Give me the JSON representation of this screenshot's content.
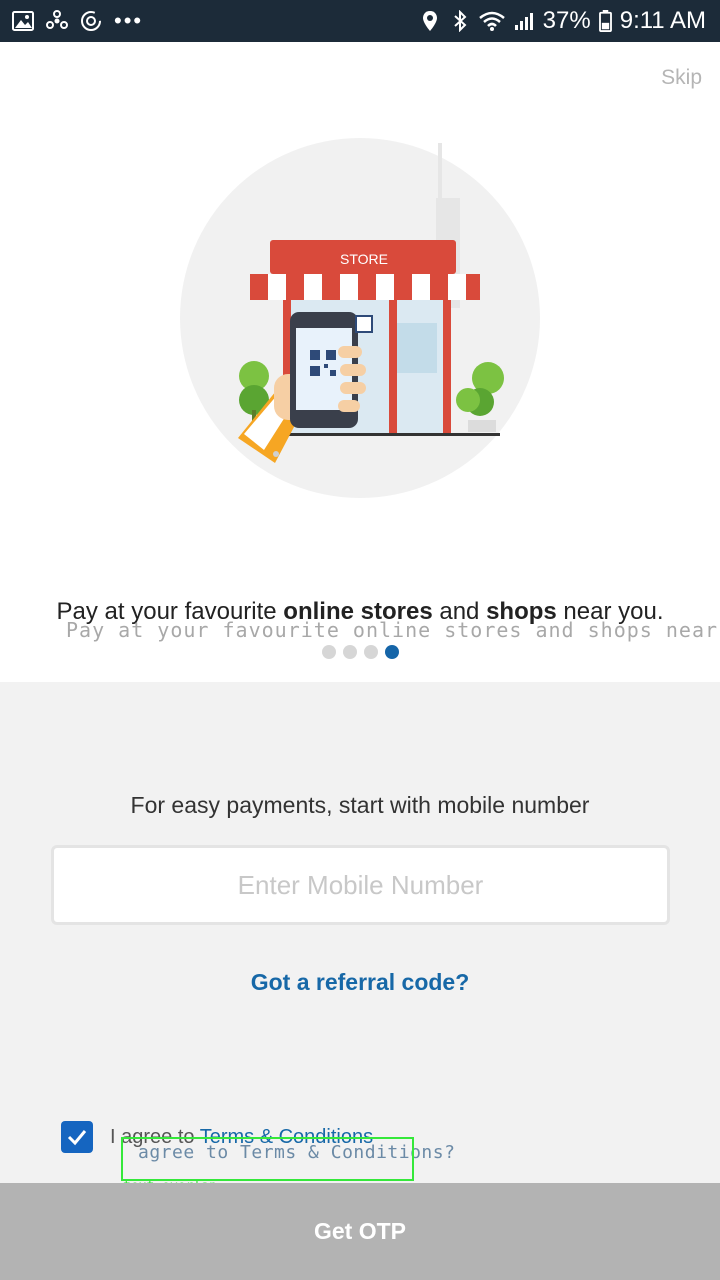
{
  "status_bar": {
    "battery": "37%",
    "time": "9:11 AM",
    "more_dots": "•••",
    "icons": [
      "gallery-icon",
      "fan-icon",
      "sync-icon",
      "location-icon",
      "bluetooth-icon",
      "wifi-icon",
      "signal-icon",
      "battery-icon"
    ]
  },
  "onboarding": {
    "skip_label": "Skip",
    "store_sign": "STORE",
    "tagline": {
      "pre": "Pay at your favourite ",
      "bold1": "online stores",
      "mid": " and ",
      "bold2": "shops",
      "post": " near you."
    },
    "tagline_overlay": "Pay at your favourite online stores and shops near you.",
    "pager": {
      "count": 4,
      "active_index": 3
    }
  },
  "form": {
    "prompt": "For easy payments, start with mobile number",
    "mobile_placeholder": "Enter Mobile Number",
    "referral_link": "Got a referral code?",
    "agree_prefix": "I agree to ",
    "agree_link": "Terms & Conditions",
    "agree_checked": true,
    "agree_overlay": "agree to Terms & Conditions?",
    "debug_label": "text overlap",
    "submit_label": "Get OTP"
  },
  "colors": {
    "status_bar": "#1c2b39",
    "accent": "#1565a8",
    "button_disabled": "#b3b3b3",
    "debug_box": "#35e83a"
  }
}
